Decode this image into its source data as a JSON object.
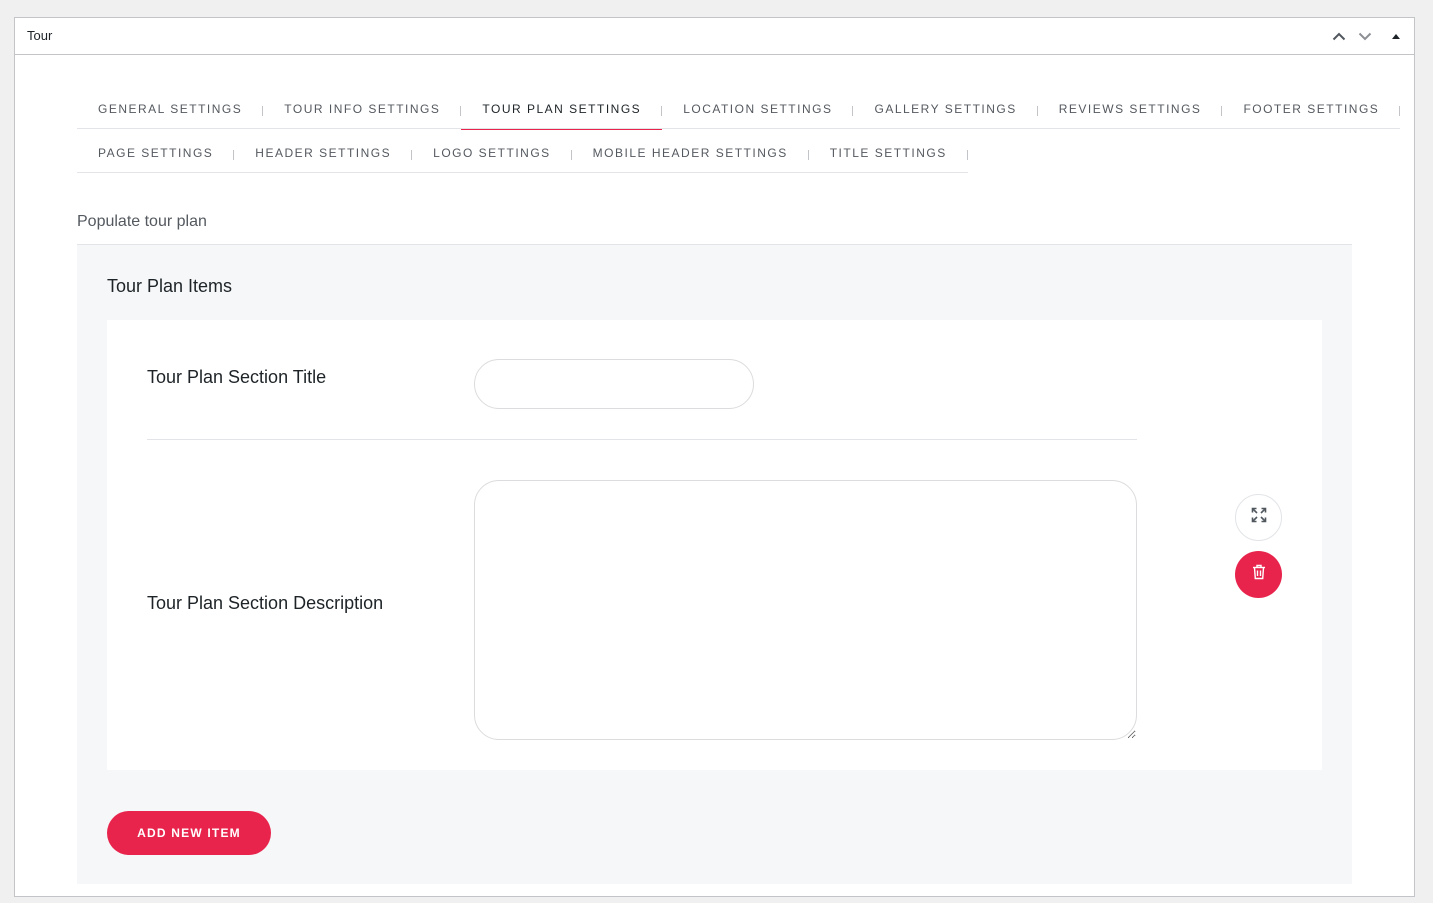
{
  "panel": {
    "title": "Tour",
    "controls": [
      {
        "name": "move-up-icon"
      },
      {
        "name": "move-down-icon"
      },
      {
        "name": "collapse-toggle-icon"
      }
    ]
  },
  "tabs_row1": [
    {
      "label": "GENERAL SETTINGS",
      "active": false
    },
    {
      "label": "TOUR INFO SETTINGS",
      "active": false
    },
    {
      "label": "TOUR PLAN SETTINGS",
      "active": true
    },
    {
      "label": "LOCATION SETTINGS",
      "active": false
    },
    {
      "label": "GALLERY SETTINGS",
      "active": false
    },
    {
      "label": "REVIEWS SETTINGS",
      "active": false
    },
    {
      "label": "FOOTER SETTINGS",
      "active": false
    }
  ],
  "tabs_row2": [
    {
      "label": "PAGE SETTINGS",
      "active": false
    },
    {
      "label": "HEADER SETTINGS",
      "active": false
    },
    {
      "label": "LOGO SETTINGS",
      "active": false
    },
    {
      "label": "MOBILE HEADER SETTINGS",
      "active": false
    },
    {
      "label": "TITLE SETTINGS",
      "active": false
    }
  ],
  "section": {
    "label": "Populate tour plan"
  },
  "items": {
    "title": "Tour Plan Items",
    "item": {
      "title_label": "Tour Plan Section Title",
      "title_value": "",
      "description_label": "Tour Plan Section Description",
      "description_value": "",
      "expand_icon": "expand-icon",
      "delete_icon": "trash-icon"
    },
    "add_button_label": "ADD NEW ITEM"
  },
  "colors": {
    "accent": "#e8244d",
    "active_tab_underline": "#e8244d",
    "panel_border": "#c3c4c7",
    "items_background": "#f6f7f8"
  }
}
